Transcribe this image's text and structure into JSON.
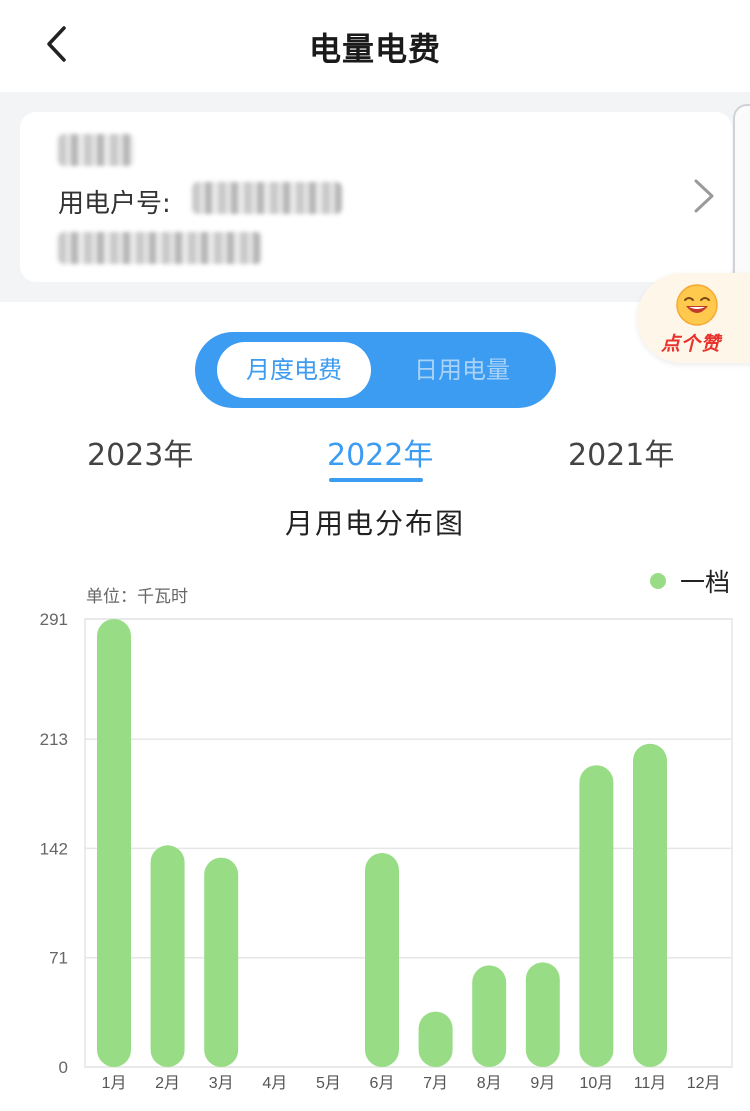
{
  "header": {
    "title": "电量电费"
  },
  "account": {
    "label": "用电户号:"
  },
  "like_badge": {
    "label": "点个赞"
  },
  "mode_tabs": {
    "active": "月度电费",
    "inactive": "日用电量"
  },
  "year_tabs": [
    {
      "label": "2023年",
      "active": false
    },
    {
      "label": "2022年",
      "active": true
    },
    {
      "label": "2021年",
      "active": false
    }
  ],
  "chart_data": {
    "type": "bar",
    "title": "月用电分布图",
    "unit_label": "单位：千瓦时",
    "categories": [
      "1月",
      "2月",
      "3月",
      "4月",
      "5月",
      "6月",
      "7月",
      "8月",
      "9月",
      "10月",
      "11月",
      "12月"
    ],
    "series": [
      {
        "name": "一档",
        "values": [
          291,
          144,
          136,
          0,
          0,
          139,
          36,
          66,
          68,
          196,
          210,
          0
        ],
        "color": "#98dd86"
      }
    ],
    "yticks": [
      0,
      71,
      142,
      213,
      291
    ],
    "ylim": [
      0,
      291
    ],
    "grid": true,
    "legend_position": "top-right"
  },
  "colors": {
    "accent": "#3c9cf2",
    "bar": "#98dd86",
    "grid": "#e6e6e6",
    "background": "#f3f4f6"
  }
}
